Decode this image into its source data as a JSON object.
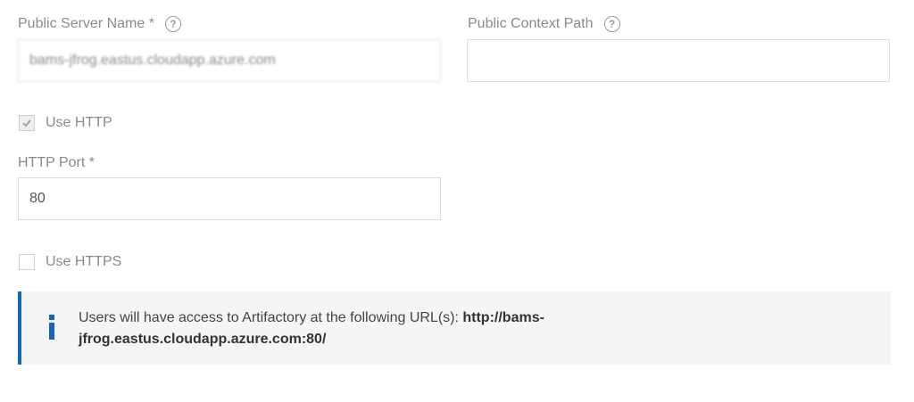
{
  "form": {
    "public_server_name": {
      "label": "Public Server Name *",
      "help_icon": "question-circle-icon",
      "value": "bams-jfrog.eastus.cloudapp.azure.com"
    },
    "public_context_path": {
      "label": "Public Context Path",
      "help_icon": "question-circle-icon",
      "value": ""
    },
    "use_http": {
      "label": "Use HTTP",
      "checked": true
    },
    "http_port": {
      "label": "HTTP Port *",
      "value": "80"
    },
    "use_https": {
      "label": "Use HTTPS",
      "checked": false
    }
  },
  "info": {
    "icon": "info-icon",
    "accent_color": "#1565c0",
    "message": "Users will have access to Artifactory at the following URL(s): ",
    "url": "http://bams-jfrog.eastus.cloudapp.azure.com:80/"
  }
}
